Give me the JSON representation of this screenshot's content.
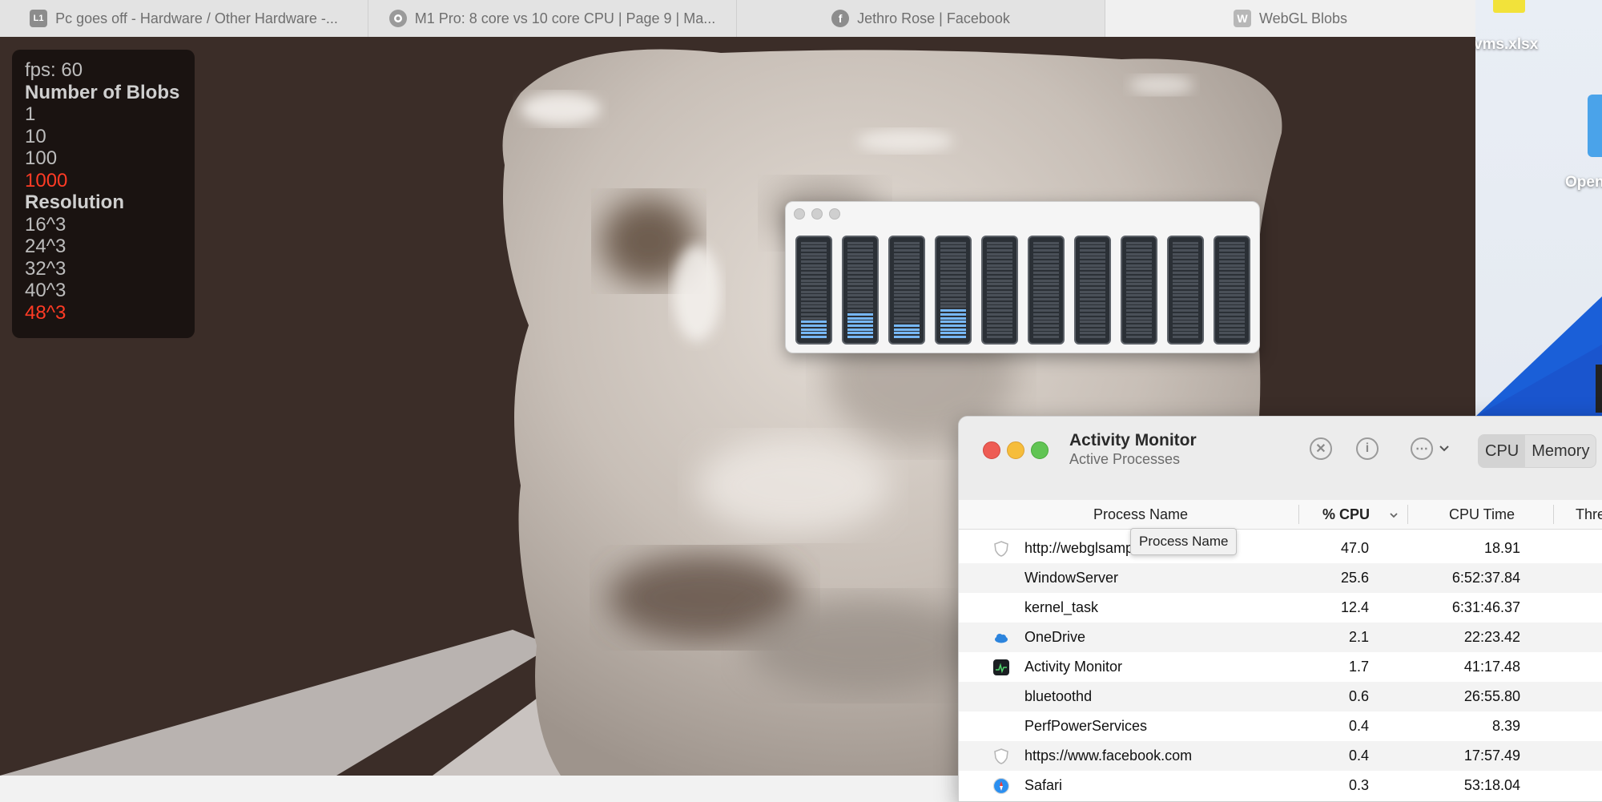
{
  "browser": {
    "tabs": [
      {
        "title": "Pc goes off - Hardware / Other Hardware -...",
        "favicon": "L1"
      },
      {
        "title": "M1 Pro: 8 core vs 10 core CPU | Page 9 | Ma...",
        "favicon": "forum-icon"
      },
      {
        "title": "Jethro Rose | Facebook",
        "favicon": "facebook-icon"
      },
      {
        "title": "WebGL Blobs",
        "favicon": "W"
      }
    ]
  },
  "desktop": {
    "file_label": "vms.xlsx",
    "folder_label": "Open"
  },
  "webgl": {
    "fps": "fps: 60",
    "blobs_heading": "Number of Blobs",
    "blob_options": [
      "1",
      "10",
      "100",
      "1000"
    ],
    "blob_selected": "1000",
    "resolution_heading": "Resolution",
    "resolution_options": [
      "16^3",
      "24^3",
      "32^3",
      "40^3",
      "48^3"
    ],
    "resolution_selected": "48^3"
  },
  "cpu_history": {
    "core_loads": [
      0.2,
      0.25,
      0.15,
      0.3,
      0,
      0,
      0,
      0,
      0,
      0
    ]
  },
  "activity_monitor": {
    "title": "Activity Monitor",
    "subtitle": "Active Processes",
    "tabs": [
      "CPU",
      "Memory"
    ],
    "active_tab": "CPU",
    "columns": {
      "name": "Process Name",
      "cpu": "% CPU",
      "time": "CPU Time",
      "threads": "Thre"
    },
    "tooltip": "Process Name",
    "processes": [
      {
        "name": "http://webglsamp",
        "cpu": "47.0",
        "time": "18.91",
        "icon": "shield-icon"
      },
      {
        "name": "WindowServer",
        "cpu": "25.6",
        "time": "6:52:37.84",
        "icon": ""
      },
      {
        "name": "kernel_task",
        "cpu": "12.4",
        "time": "6:31:46.37",
        "icon": ""
      },
      {
        "name": "OneDrive",
        "cpu": "2.1",
        "time": "22:23.42",
        "icon": "cloud-icon"
      },
      {
        "name": "Activity Monitor",
        "cpu": "1.7",
        "time": "41:17.48",
        "icon": "activity-monitor-icon"
      },
      {
        "name": "bluetoothd",
        "cpu": "0.6",
        "time": "26:55.80",
        "icon": ""
      },
      {
        "name": "PerfPowerServices",
        "cpu": "0.4",
        "time": "8.39",
        "icon": ""
      },
      {
        "name": "https://www.facebook.com",
        "cpu": "0.4",
        "time": "17:57.49",
        "icon": "shield-icon"
      },
      {
        "name": "Safari",
        "cpu": "0.3",
        "time": "53:18.04",
        "icon": "safari-icon"
      }
    ]
  }
}
